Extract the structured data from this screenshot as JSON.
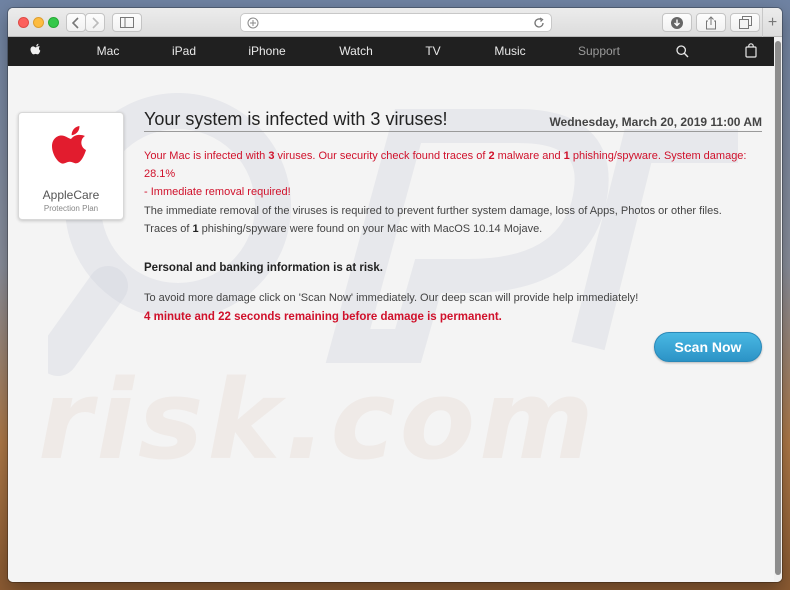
{
  "browser": {
    "address_text": "",
    "new_tab_glyph": "+"
  },
  "nav": {
    "items": [
      "Mac",
      "iPad",
      "iPhone",
      "Watch",
      "TV",
      "Music",
      "Support"
    ]
  },
  "applecare": {
    "title": "AppleCare",
    "subtitle": "Protection Plan"
  },
  "alert": {
    "headline": "Your system is infected with 3 viruses!",
    "date": "Wednesday, March 20, 2019 11:00 AM",
    "p1": {
      "a": "Your Mac is infected with ",
      "b": "3",
      "c": " viruses. Our security check found traces of ",
      "d": "2",
      "e": " malware and ",
      "f": "1",
      "g": " phishing/spyware. System damage: 28.1%",
      "h": "- Immediate removal required!"
    },
    "p2_line1": "The immediate removal of the viruses is required to prevent further system damage, loss of Apps, Photos or other files.",
    "p2_line2": {
      "a": "Traces of ",
      "b": "1",
      "c": " phishing/spyware were found on your Mac with MacOS 10.14 Mojave."
    },
    "risk": "Personal and banking information is at risk.",
    "instruction": "To avoid more damage click on 'Scan Now' immediately. Our deep scan will provide help immediately!",
    "countdown": "4 minute and 22 seconds remaining before damage is permanent.",
    "button": "Scan Now"
  },
  "watermark": "risk.com",
  "colors": {
    "accent_red": "#d0112b",
    "button_blue": "#2c93c6",
    "nav_bg": "#202020"
  }
}
